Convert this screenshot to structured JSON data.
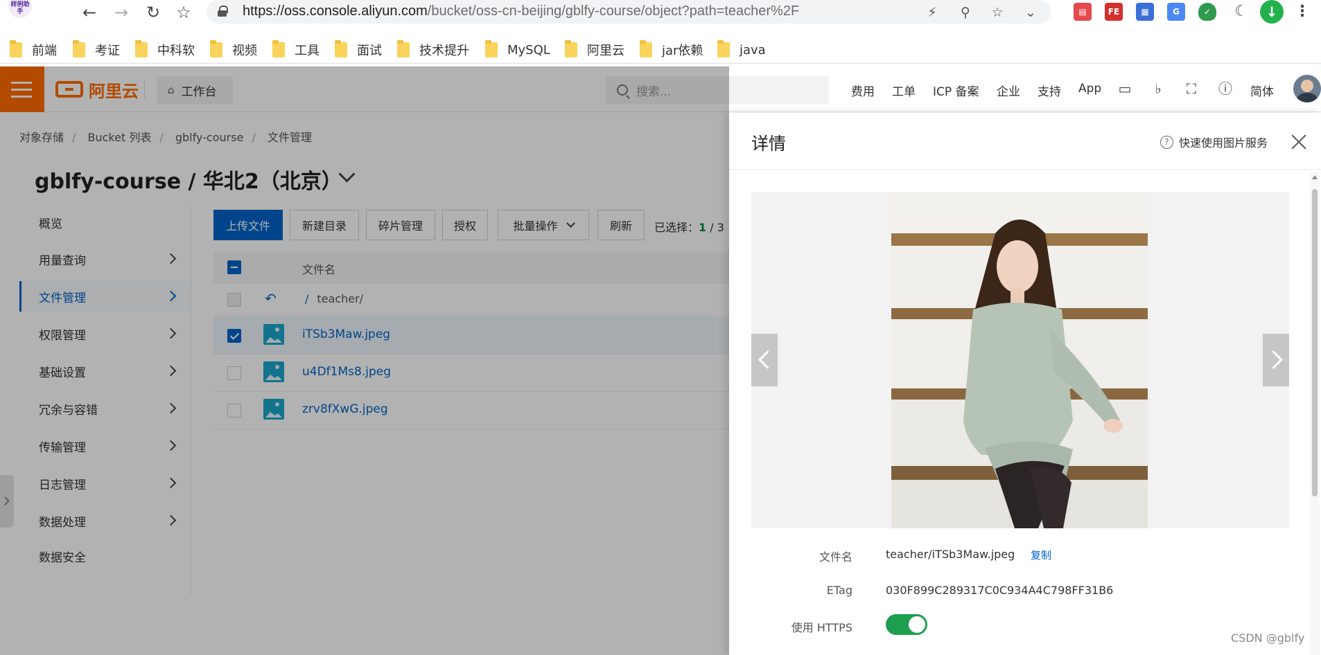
{
  "browser": {
    "favicon_text": "样例助手",
    "url_host": "https://oss.console.aliyun.com",
    "url_path": "/bucket/oss-cn-beijing/gblfy-course/object?path=teacher%2F",
    "bookmarks": [
      "前端",
      "考证",
      "中科软",
      "视频",
      "工具",
      "面试",
      "技术提升",
      "MySQL",
      "阿里云",
      "jar依赖",
      "java"
    ]
  },
  "header": {
    "logo_text": "阿里云",
    "workbench_label": "工作台",
    "search_placeholder": "搜索...",
    "links": [
      "费用",
      "工单",
      "ICP 备案",
      "企业",
      "支持",
      "App"
    ],
    "lang_label": "简体"
  },
  "breadcrumb": [
    "对象存储",
    "Bucket 列表",
    "gblfy-course",
    "文件管理"
  ],
  "page_title": "gblfy-course / 华北2（北京）",
  "leftnav": [
    {
      "label": "概览",
      "has_arrow": false
    },
    {
      "label": "用量查询",
      "has_arrow": true
    },
    {
      "label": "文件管理",
      "has_arrow": true,
      "active": true
    },
    {
      "label": "权限管理",
      "has_arrow": true
    },
    {
      "label": "基础设置",
      "has_arrow": true
    },
    {
      "label": "冗余与容错",
      "has_arrow": true
    },
    {
      "label": "传输管理",
      "has_arrow": true
    },
    {
      "label": "日志管理",
      "has_arrow": true
    },
    {
      "label": "数据处理",
      "has_arrow": true
    },
    {
      "label": "数据安全",
      "has_arrow": false
    }
  ],
  "toolbar": {
    "upload": "上传文件",
    "new_dir": "新建目录",
    "fragments": "碎片管理",
    "authorize": "授权",
    "batch": "批量操作",
    "refresh": "刷新",
    "selected_prefix": "已选择：",
    "selected_count": "1",
    "selected_total": "/ 3"
  },
  "table": {
    "col_name": "文件名",
    "parent_slash": "/",
    "parent_path": "teacher/",
    "files": [
      {
        "name": "iTSb3Maw.jpeg",
        "checked": true
      },
      {
        "name": "u4Df1Ms8.jpeg",
        "checked": false
      },
      {
        "name": "zrv8fXwG.jpeg",
        "checked": false
      }
    ]
  },
  "drawer": {
    "title": "详情",
    "help_label": "快速使用图片服务",
    "fields": {
      "filename_label": "文件名",
      "filename_value": "teacher/iTSb3Maw.jpeg",
      "copy_label": "复制",
      "etag_label": "ETag",
      "etag_value": "030F899C289317C0C934A4C798FF31B6",
      "https_label": "使用 HTTPS",
      "https_enabled": true
    }
  },
  "watermark": "CSDN @gblfy",
  "colors": {
    "brand": "#ff6a00",
    "primary": "#0064c8",
    "toggle_on": "#1e9e4f"
  }
}
